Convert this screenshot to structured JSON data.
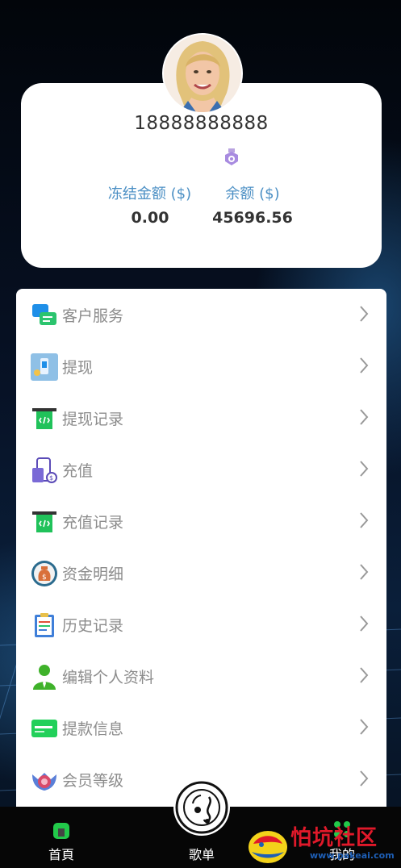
{
  "profile": {
    "phone": "18888888888",
    "frozen_label": "冻结金额 ($)",
    "frozen_value": "0.00",
    "balance_label": "余额 ($)",
    "balance_value": "45696.56"
  },
  "menu": {
    "items": [
      {
        "label": "客户服务",
        "icon": "customer-service-icon"
      },
      {
        "label": "提现",
        "icon": "withdraw-icon"
      },
      {
        "label": "提现记录",
        "icon": "withdraw-record-icon"
      },
      {
        "label": "充值",
        "icon": "recharge-icon"
      },
      {
        "label": "充值记录",
        "icon": "recharge-record-icon"
      },
      {
        "label": "资金明细",
        "icon": "money-bag-icon"
      },
      {
        "label": "历史记录",
        "icon": "clipboard-icon"
      },
      {
        "label": "编辑个人资料",
        "icon": "user-profile-icon"
      },
      {
        "label": "提款信息",
        "icon": "card-icon"
      },
      {
        "label": "会员等级",
        "icon": "vip-level-icon"
      }
    ]
  },
  "tabbar": {
    "home": "首頁",
    "playlist": "歌单",
    "mine": "我的"
  },
  "watermark": {
    "text": "怕坑社区",
    "url": "www.pakeai.com"
  },
  "colors": {
    "accent_blue": "#4b8fc4",
    "card_bg": "#ffffff",
    "tab_bg": "#060606"
  }
}
